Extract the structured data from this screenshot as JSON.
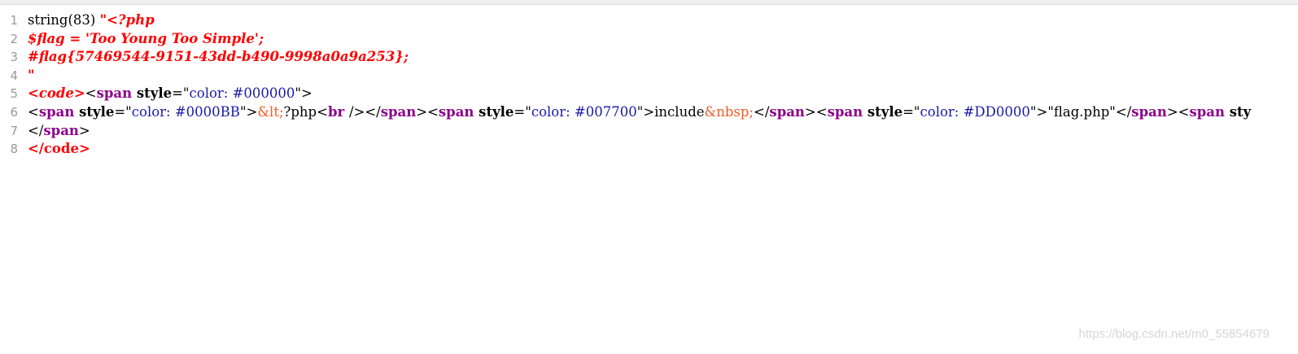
{
  "lines": [
    {
      "number": "1",
      "segments": [
        {
          "text": "string(83) ",
          "style": "plain"
        },
        {
          "text": "\"<?php",
          "style": "ital"
        }
      ]
    },
    {
      "number": "2",
      "segments": [
        {
          "text": "$flag = 'Too Young Too Simple';",
          "style": "ital"
        }
      ]
    },
    {
      "number": "3",
      "segments": [
        {
          "text": "#flag{57469544-9151-43dd-b490-9998a0a9a253};",
          "style": "ital"
        }
      ]
    },
    {
      "number": "4",
      "segments": [
        {
          "text": "\"",
          "style": "ital"
        }
      ]
    },
    {
      "number": "5",
      "segments": [
        {
          "text": "<code>",
          "style": "red-ital"
        },
        {
          "text": "<",
          "style": "plain"
        },
        {
          "text": "span ",
          "style": "tag"
        },
        {
          "text": "style",
          "style": "attr"
        },
        {
          "text": "=\"",
          "style": "plain"
        },
        {
          "text": "color: #000000",
          "style": "val"
        },
        {
          "text": "\">",
          "style": "plain"
        }
      ]
    },
    {
      "number": "6",
      "segments": [
        {
          "text": "<",
          "style": "plain"
        },
        {
          "text": "span ",
          "style": "tag"
        },
        {
          "text": "style",
          "style": "attr"
        },
        {
          "text": "=\"",
          "style": "plain"
        },
        {
          "text": "color: #0000BB",
          "style": "val"
        },
        {
          "text": "\">",
          "style": "plain"
        },
        {
          "text": "&lt;",
          "style": "ent"
        },
        {
          "text": "?php",
          "style": "plain"
        },
        {
          "text": "<",
          "style": "plain"
        },
        {
          "text": "br ",
          "style": "tag"
        },
        {
          "text": "/>",
          "style": "plain"
        },
        {
          "text": "</",
          "style": "plain"
        },
        {
          "text": "span",
          "style": "tag"
        },
        {
          "text": ">",
          "style": "plain"
        },
        {
          "text": "<",
          "style": "plain"
        },
        {
          "text": "span ",
          "style": "tag"
        },
        {
          "text": "style",
          "style": "attr"
        },
        {
          "text": "=\"",
          "style": "plain"
        },
        {
          "text": "color: #007700",
          "style": "val"
        },
        {
          "text": "\">",
          "style": "plain"
        },
        {
          "text": "include",
          "style": "plain"
        },
        {
          "text": "&nbsp;",
          "style": "ent"
        },
        {
          "text": "</",
          "style": "plain"
        },
        {
          "text": "span",
          "style": "tag"
        },
        {
          "text": ">",
          "style": "plain"
        },
        {
          "text": "<",
          "style": "plain"
        },
        {
          "text": "span ",
          "style": "tag"
        },
        {
          "text": "style",
          "style": "attr"
        },
        {
          "text": "=\"",
          "style": "plain"
        },
        {
          "text": "color: #DD0000",
          "style": "val"
        },
        {
          "text": "\">",
          "style": "plain"
        },
        {
          "text": "\"flag.php\"",
          "style": "plain"
        },
        {
          "text": "</",
          "style": "plain"
        },
        {
          "text": "span",
          "style": "tag"
        },
        {
          "text": ">",
          "style": "plain"
        },
        {
          "text": "<",
          "style": "plain"
        },
        {
          "text": "span ",
          "style": "tag"
        },
        {
          "text": "sty",
          "style": "attr"
        }
      ]
    },
    {
      "number": "7",
      "segments": [
        {
          "text": "</",
          "style": "plain"
        },
        {
          "text": "span",
          "style": "tag"
        },
        {
          "text": ">",
          "style": "plain"
        }
      ]
    },
    {
      "number": "8",
      "segments": [
        {
          "text": "</code>",
          "style": "red-tag"
        }
      ]
    }
  ],
  "watermark": "https://blog.csdn.net/m0_55854679"
}
